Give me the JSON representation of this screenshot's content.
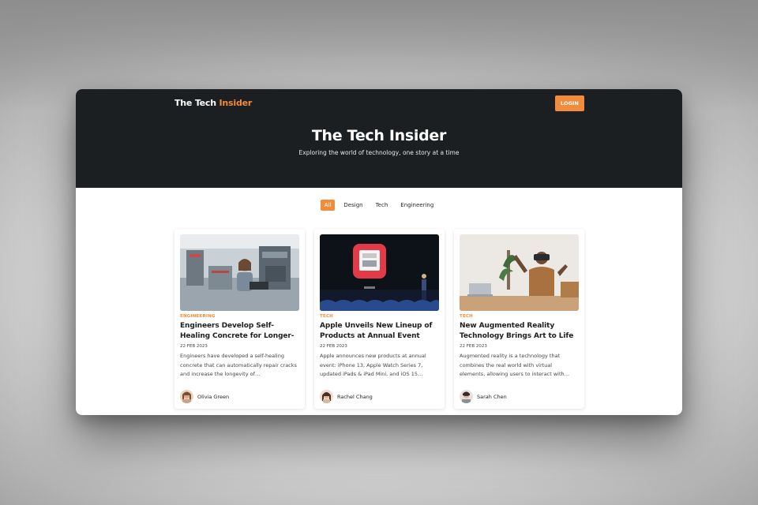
{
  "colors": {
    "accent": "#f28c3a",
    "hero_bg": "#1c1f22"
  },
  "header": {
    "logo_main": "The Tech ",
    "logo_accent": "Insider",
    "login_label": "LOGIN"
  },
  "hero": {
    "title": "The Tech Insider",
    "subtitle": "Exploring the world of technology, one story at a time"
  },
  "filters": [
    {
      "label": "All",
      "active": true
    },
    {
      "label": "Design",
      "active": false
    },
    {
      "label": "Tech",
      "active": false
    },
    {
      "label": "Engineering",
      "active": false
    }
  ],
  "cards": [
    {
      "category": "ENGINEERING",
      "title": "Engineers Develop Self-Healing Concrete for Longer-Lasting…",
      "date": "22 FEB 2023",
      "excerpt": "Engineers have developed a self-healing concrete that can automatically repair cracks and increase the longevity of…",
      "author": "Olivia Green",
      "image": "lab-worker-photo"
    },
    {
      "category": "TECH",
      "title": "Apple Unveils New Lineup of Products at Annual Event",
      "date": "22 FEB 2023",
      "excerpt": "Apple announces new products at annual event: iPhone 13, Apple Watch Series 7, updated iPads & iPad Mini, and iOS 15…",
      "author": "Rachel Chang",
      "image": "keynote-stage-photo"
    },
    {
      "category": "TECH",
      "title": "New Augmented Reality Technology Brings Art to Life",
      "date": "22 FEB 2023",
      "excerpt": "Augmented reality is a technology that combines the real world with virtual elements, allowing users to interact with…",
      "author": "Sarah Chen",
      "image": "vr-headset-photo"
    }
  ]
}
